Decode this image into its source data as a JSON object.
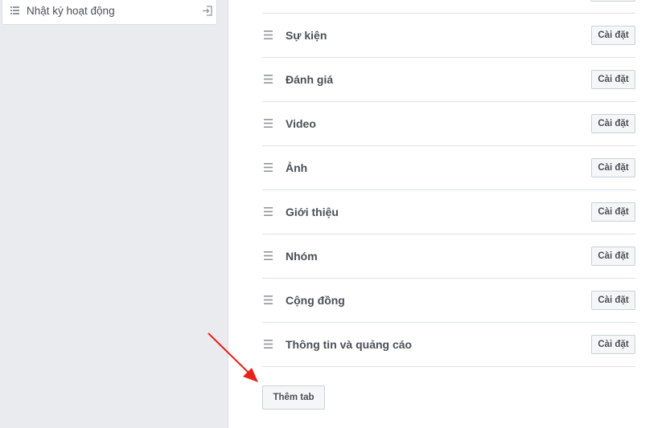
{
  "sidebar": {
    "activity_log_label": "Nhật ký hoạt động",
    "list_icon": "list-icon",
    "exit_icon": "exit-icon"
  },
  "tabs": [
    {
      "label": "Sự kiện",
      "button": "Cài đặt"
    },
    {
      "label": "Đánh giá",
      "button": "Cài đặt"
    },
    {
      "label": "Video",
      "button": "Cài đặt"
    },
    {
      "label": "Ảnh",
      "button": "Cài đặt"
    },
    {
      "label": "Giới thiệu",
      "button": "Cài đặt"
    },
    {
      "label": "Nhóm",
      "button": "Cài đặt"
    },
    {
      "label": "Cộng đồng",
      "button": "Cài đặt"
    },
    {
      "label": "Thông tin và quảng cáo",
      "button": "Cài đặt"
    }
  ],
  "add_tab_label": "Thêm tab",
  "annotation": {
    "arrow_color": "#e8211b"
  }
}
